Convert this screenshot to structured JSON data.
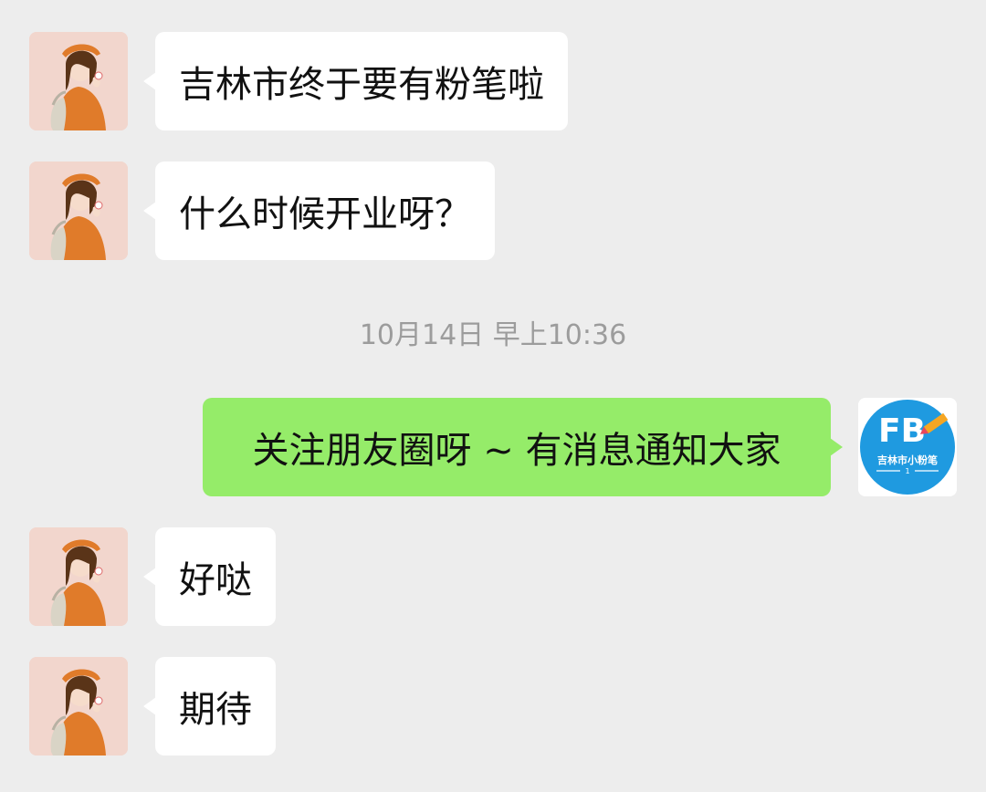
{
  "messages": [
    {
      "side": "left",
      "text": "吉林市终于要有粉笔啦"
    },
    {
      "side": "left",
      "text": "什么时候开业呀？"
    },
    {
      "side": "right",
      "text": "关注朋友圈呀 ~ 有消息通知大家"
    },
    {
      "side": "left",
      "text": "好哒"
    },
    {
      "side": "left",
      "text": "期待"
    }
  ],
  "timestamp": "10月14日 早上10:36",
  "brand_avatar": {
    "logo_text": "FB",
    "caption": "吉林市小粉笔",
    "number": "1",
    "colors": {
      "circle": "#1f9ae0",
      "pencil": "#f5a623",
      "pencil_tip": "#e8465a"
    }
  },
  "colors": {
    "background": "#ededed",
    "incoming_bubble": "#ffffff",
    "outgoing_bubble": "#95ec69",
    "timestamp_text": "#9c9c9c"
  }
}
